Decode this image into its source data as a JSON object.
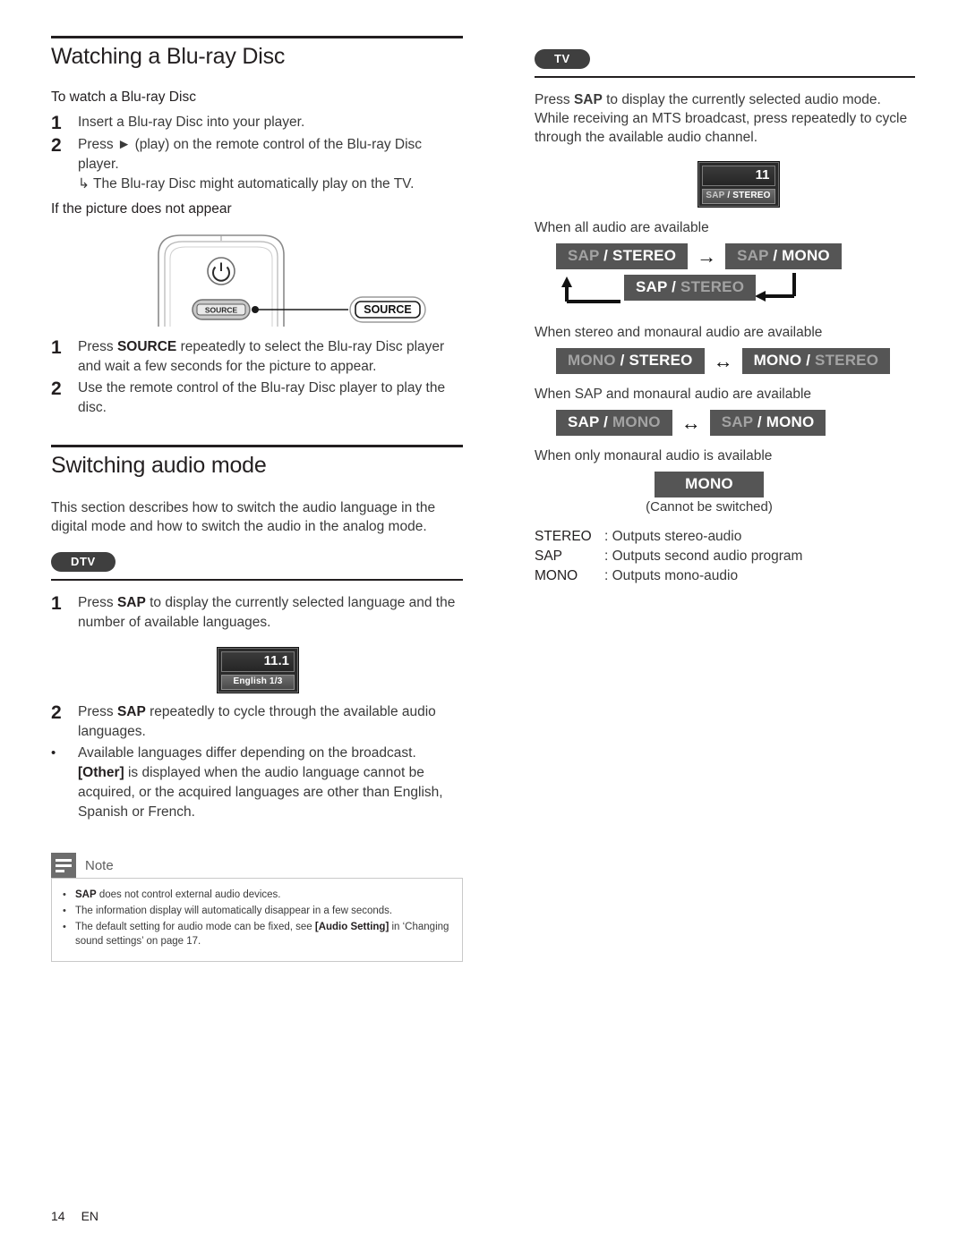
{
  "document": {
    "footer_page": "14",
    "footer_lang": "EN"
  },
  "left_column": {
    "section_title": "Watching a Blu-ray Disc",
    "sub_head": "To watch a Blu-ray Disc",
    "steps_watch": [
      {
        "num": "1",
        "text": "Insert a Blu-ray Disc into your player."
      },
      {
        "num": "2",
        "text": "Press ► (play) on the remote control of the Blu-ray Disc player.",
        "sub": "↳  The Blu-ray Disc might automatically play on the TV."
      }
    ],
    "picture_head": "If the picture does not appear",
    "remote": {
      "power_icon": "power-icon",
      "source_button_label": "SOURCE",
      "callout_label": "SOURCE"
    },
    "steps_picture": [
      {
        "num": "1",
        "text_pre": "Press ",
        "bold": "SOURCE",
        "text_post": " repeatedly to select the Blu-ray Disc player and wait a few seconds for the picture to appear."
      },
      {
        "num": "2",
        "text_pre": "Use the remote control of the Blu-ray Disc player to play the disc.",
        "bold": "",
        "text_post": ""
      }
    ],
    "audio_section_title": "Switching audio mode",
    "audio_intro": "This section describes how to switch the audio language in the digital mode and how to switch the audio in the analog mode.",
    "dtv_pill": "DTV",
    "dtv_steps": [
      {
        "num": "1",
        "text_pre": "Press ",
        "bold": "SAP",
        "text_post": " to display the currently selected language and the number of available languages."
      },
      {
        "num": "2",
        "text_pre": "Press ",
        "bold": "SAP",
        "text_post": " repeatedly to cycle through the available audio languages."
      }
    ],
    "dtv_bullet": {
      "num": "•",
      "text_pre": "Available languages differ depending on the broadcast. ",
      "bold": "[Other]",
      "text_post": " is displayed when the audio language cannot be acquired, or the acquired languages are other than English, Spanish or French."
    },
    "dtv_osd": {
      "channel": "11.1",
      "status": "English 1/3"
    },
    "note": {
      "title": "Note",
      "icon": "note-lines-icon",
      "items": [
        {
          "bold": "SAP",
          "text": " does not control external audio devices."
        },
        {
          "bold": "",
          "text": "The information display will automatically disappear in a few seconds."
        },
        {
          "bold": "",
          "text": "The default setting for audio mode can be fixed, see ",
          "bold2": "[Audio Setting]",
          "text2": " in ‘Changing sound settings’ on page 17."
        }
      ]
    }
  },
  "right_column": {
    "tv_pill": "TV",
    "intro_pre": "Press ",
    "intro_bold": "SAP",
    "intro_post": " to display the currently selected audio mode. While receiving an MTS broadcast, press repeatedly to cycle through the available audio channel.",
    "tv_osd": {
      "channel": "11",
      "status_dim": "SAP",
      "status_sep": " / ",
      "status_on": "STEREO"
    },
    "caption_all": "When all audio are available",
    "cycle_all": [
      {
        "left": "SAP",
        "left_state": "off",
        "right": "STEREO",
        "right_state": "on"
      },
      {
        "left": "SAP",
        "left_state": "off",
        "right": "MONO",
        "right_state": "on"
      },
      {
        "left": "SAP",
        "left_state": "on",
        "right": "STEREO",
        "right_state": "off"
      }
    ],
    "caption_stereo_mono": "When stereo and monaural audio are available",
    "cycle_stereo_mono": [
      {
        "left": "MONO",
        "left_state": "off",
        "right": "STEREO",
        "right_state": "on"
      },
      {
        "left": "MONO",
        "left_state": "on",
        "right": "STEREO",
        "right_state": "off"
      }
    ],
    "caption_sap_mono": "When SAP and monaural audio are available",
    "cycle_sap_mono": [
      {
        "left": "SAP",
        "left_state": "on",
        "right": "MONO",
        "right_state": "off"
      },
      {
        "left": "SAP",
        "left_state": "off",
        "right": "MONO",
        "right_state": "on"
      }
    ],
    "caption_mono_only": "When only monaural audio is available",
    "mono_badge": "MONO",
    "mono_note": "(Cannot be switched)",
    "legend": [
      {
        "term": "STEREO",
        "def": ": Outputs stereo-audio"
      },
      {
        "term": "SAP",
        "def": ": Outputs second audio program"
      },
      {
        "term": "MONO",
        "def": ": Outputs mono-audio"
      }
    ],
    "arrow_right": "→",
    "arrow_both": "↔"
  },
  "colors": {
    "badge_bg": "#555555",
    "badge_on": "#ffffff",
    "badge_off": "#a3a3a3",
    "pill_bg": "#3f3f3f",
    "note_icon_bg": "#6d6d6d"
  }
}
